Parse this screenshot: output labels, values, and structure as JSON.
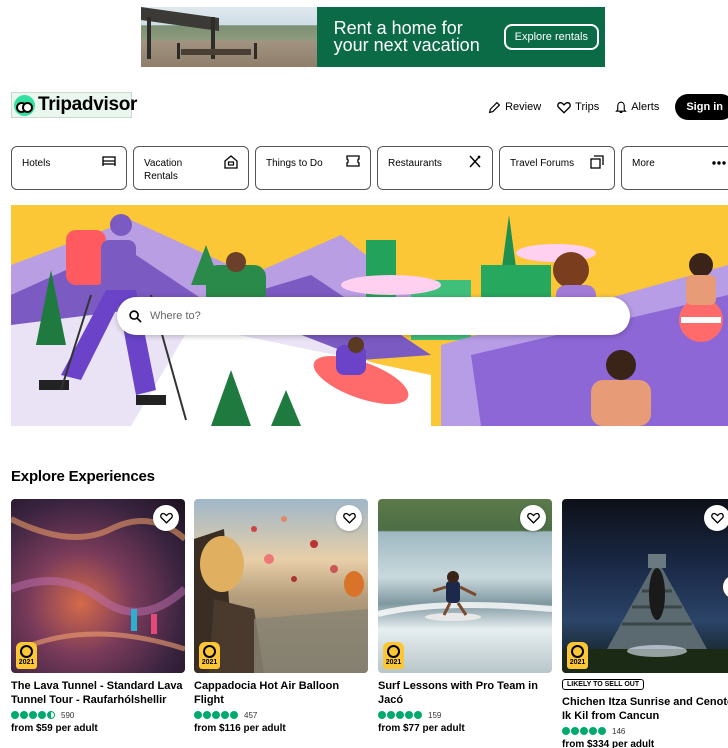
{
  "ad": {
    "headline_line1": "Rent a home for",
    "headline_line2": "your next vacation",
    "cta": "Explore rentals"
  },
  "header": {
    "logo_text": "Tripadvisor",
    "review_label": "Review",
    "trips_label": "Trips",
    "alerts_label": "Alerts",
    "signin_label": "Sign in"
  },
  "categories": [
    {
      "label": "Hotels",
      "icon": "bed-icon"
    },
    {
      "label": "Vacation Rentals",
      "icon": "house-icon"
    },
    {
      "label": "Things to Do",
      "icon": "ticket-icon"
    },
    {
      "label": "Restaurants",
      "icon": "fork-knife-icon"
    },
    {
      "label": "Travel Forums",
      "icon": "chat-icon"
    },
    {
      "label": "More",
      "icon": "ellipsis-icon"
    }
  ],
  "search": {
    "placeholder": "Where to?"
  },
  "experiences": {
    "title": "Explore Experiences",
    "cards": [
      {
        "title": "The Lava Tunnel - Standard Lava Tunnel Tour - Raufarhólshellir",
        "rating": 4.5,
        "review_count": "590",
        "price": "from $59 per adult",
        "badge": "2021",
        "tag": ""
      },
      {
        "title": "Cappadocia Hot Air Balloon Flight",
        "rating": 5,
        "review_count": "457",
        "price": "from $116 per adult",
        "badge": "2021",
        "tag": ""
      },
      {
        "title": "Surf Lessons with Pro Team in Jacó",
        "rating": 5,
        "review_count": "159",
        "price": "from $77 per adult",
        "badge": "2021",
        "tag": ""
      },
      {
        "title": "Chichen Itza Sunrise and Cenote Ik Kil from Cancun",
        "rating": 5,
        "review_count": "146",
        "price": "from $334 per adult",
        "badge": "2021",
        "tag": "LIKELY TO SELL OUT"
      }
    ]
  },
  "colors": {
    "brand_green": "#34e0a1",
    "ad_green": "#0b6b47",
    "rating_green": "#00aa6c",
    "hero_yellow": "#fcc737"
  }
}
